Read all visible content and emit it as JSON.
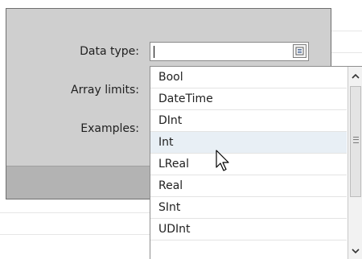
{
  "dialog": {
    "fields": [
      {
        "label": "Data type:"
      },
      {
        "label": "Array limits:"
      },
      {
        "label": "Examples:"
      }
    ],
    "data_type_input": {
      "value": ""
    }
  },
  "dropdown": {
    "items": [
      {
        "label": "Bool"
      },
      {
        "label": "DateTime"
      },
      {
        "label": "DInt"
      },
      {
        "label": "Int"
      },
      {
        "label": "LReal"
      },
      {
        "label": "Real"
      },
      {
        "label": "SInt"
      },
      {
        "label": "UDInt"
      }
    ],
    "hovered_item": "Int"
  },
  "icons": {
    "list_button": "list-icon",
    "scroll_up": "chevron-up-icon",
    "scroll_down": "chevron-down-icon",
    "cursor": "mouse-pointer-icon"
  },
  "colors": {
    "dialog_bg": "#cfcfcf",
    "footer_bg": "#b3b3b3",
    "hover_bg": "#e8eff5"
  }
}
